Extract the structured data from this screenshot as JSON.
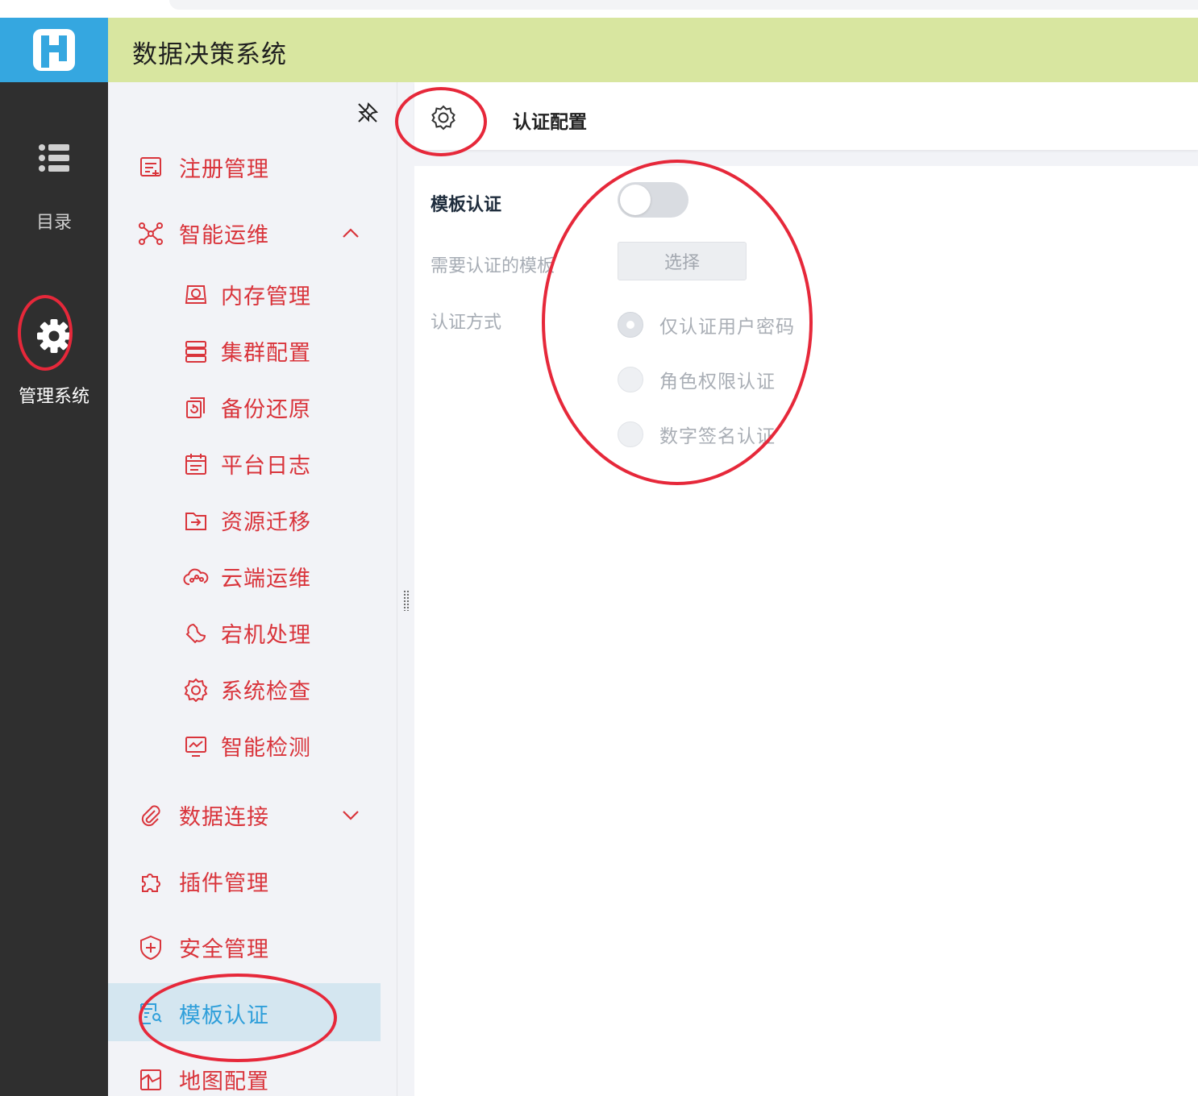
{
  "app": {
    "title": "数据决策系统"
  },
  "rail": {
    "items": [
      {
        "label": "目录",
        "icon": "list-icon"
      },
      {
        "label": "管理系统",
        "icon": "gear-icon"
      }
    ]
  },
  "menu": {
    "items": [
      {
        "label": "注册管理",
        "icon": "register-icon"
      },
      {
        "label": "智能运维",
        "icon": "ops-network-icon",
        "expanded": true
      },
      {
        "label": "数据连接",
        "icon": "paperclip-icon",
        "expanded": false
      },
      {
        "label": "插件管理",
        "icon": "puzzle-icon"
      },
      {
        "label": "安全管理",
        "icon": "shield-plus-icon"
      },
      {
        "label": "模板认证",
        "icon": "template-auth-icon",
        "active": true
      },
      {
        "label": "地图配置",
        "icon": "map-icon"
      }
    ],
    "sub_items": [
      {
        "label": "内存管理",
        "icon": "memory-icon"
      },
      {
        "label": "集群配置",
        "icon": "server-stack-icon"
      },
      {
        "label": "备份还原",
        "icon": "backup-restore-icon"
      },
      {
        "label": "平台日志",
        "icon": "calendar-log-icon"
      },
      {
        "label": "资源迁移",
        "icon": "folder-move-icon"
      },
      {
        "label": "云端运维",
        "icon": "cloud-ops-icon"
      },
      {
        "label": "宕机处理",
        "icon": "wrench-icon"
      },
      {
        "label": "系统检查",
        "icon": "gear-outline-icon"
      },
      {
        "label": "智能检测",
        "icon": "monitor-pulse-icon"
      }
    ]
  },
  "content": {
    "header_title": "认证配置",
    "form": {
      "template_auth_label": "模板认证",
      "template_auth_enabled": false,
      "templates_label": "需要认证的模板",
      "select_button": "选择",
      "method_label": "认证方式",
      "methods": [
        {
          "label": "仅认证用户密码",
          "checked": true
        },
        {
          "label": "角色权限认证",
          "checked": false
        },
        {
          "label": "数字签名认证",
          "checked": false
        }
      ]
    }
  },
  "colors": {
    "accent_red": "#d9343b",
    "active_blue": "#2f9fda",
    "top_bar": "#d8e6a0",
    "logo_bg": "#35a7e0",
    "rail_bg": "#2f2f2f",
    "annotation_red": "#e6283a"
  }
}
